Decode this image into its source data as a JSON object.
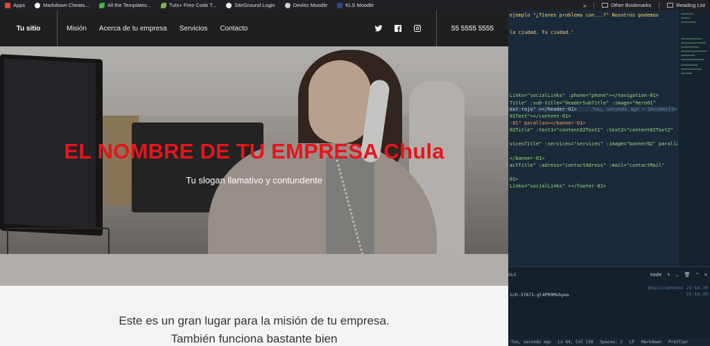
{
  "bookmarks": {
    "items": [
      {
        "label": "Apps",
        "color": "#e8453c"
      },
      {
        "label": "Markdown Cheats...",
        "color": "#ffffff"
      },
      {
        "label": "All the Templates...",
        "color": "#4caf50"
      },
      {
        "label": "Tuts+ Free Code T...",
        "color": "#7cb342"
      },
      {
        "label": "SiteGround Login",
        "color": "#f2f2f2"
      },
      {
        "label": "Devlez Moodle",
        "color": "#cfcfcf"
      },
      {
        "label": "KLS Moodle",
        "color": "#2b4a8a"
      }
    ],
    "overflow": "»",
    "other": "Other Bookmarks",
    "reading": "Reading List"
  },
  "site": {
    "brand": "Tu sitio",
    "nav": [
      "Misión",
      "Acerca de tu empresa",
      "Servicios",
      "Contacto"
    ],
    "social_icons": [
      "twitter-icon",
      "facebook-icon",
      "instagram-icon"
    ],
    "phone": "55 5555 5555",
    "hero_title": "EL NOMBRE DE TU EMPRESA Chula",
    "hero_subtitle": "Tu slogan llamativo y contundente",
    "mission_text": "Este es un gran lugar para la misión de tu empresa. También funciona bastante bien",
    "accent": "#e8141b"
  },
  "editor": {
    "lines": [
      "ejemplo \"¿Tienes problema con...?\" Nosotros podemos",
      "la ciudad. Tu ciudad.'",
      "Links=\"socialLinks\" :phone=\"phone\"></navigation-01>",
      "Title\" :sub-title=\"headerSubTitle\" :image=\"hero01\"",
      "ext-rojo\" ></header-01>",
      "01Text\"></content-01>",
      "-01\" parallax></banner-01>",
      "02Title\" :text1=\"content02Text1\" :text2=\"content02Text2\"",
      "vicesTitle\" :services=\"services\" :image=\"banner02\" parallax",
      "</banner-01>",
      "actTitle\" :adress=\"contactAdress\" :mail=\"contactMail\"",
      "01>",
      "Links=\"socialLinks\" ></footer-01>"
    ],
    "blame": "You, seconds ago • Uncommitted",
    "terminal": {
      "title": "OLE",
      "shell": "node",
      "line1": "ich-37671-gl4PR9Mshyws",
      "line2": "@nuxt/content 21:16:30",
      "line3": "21:16:30"
    },
    "status": [
      "You, seconds ago",
      "Ln 64, Col 139",
      "Spaces: 2",
      "LF",
      "Markdown",
      "Prettier"
    ]
  }
}
